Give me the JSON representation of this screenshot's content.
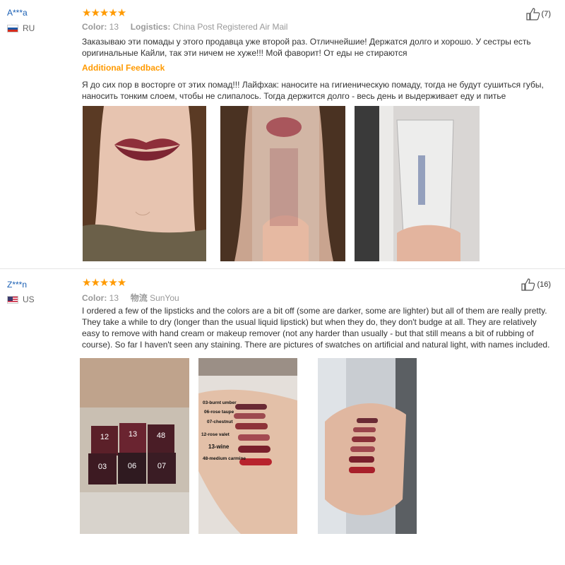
{
  "reviews": [
    {
      "user": "A***a",
      "country": "RU",
      "stars": "★★★★★",
      "color_label": "Color:",
      "color_value": "13",
      "logistics_label": "Logistics:",
      "logistics_value": "China Post Registered Air Mail",
      "likes": "(7)",
      "text": "Заказываю эти помады у этого продавца уже второй раз. Отличнейшие! Держатся долго и хорошо. У сестры есть оригинальные Кайли, так эти ничем не хуже!!! Мой фаворит! От еды не стираются",
      "additional_title": "Additional Feedback",
      "additional_text": "Я до сих пор в восторге от этих помад!!! Лайфхак: наносите на гигиеническую помаду, тогда не будут сушиться губы, наносить тонким слоем, чтобы не слипалось. Тогда держится долго - весь день и выдерживает еду и питье"
    },
    {
      "user": "Z***n",
      "country": "US",
      "stars": "★★★★★",
      "color_label": "Color:",
      "color_value": "13",
      "logistics_label": "物流",
      "logistics_value": "SunYou",
      "likes": "(16)",
      "text": "I ordered a few of the lipsticks and the colors are a bit off (some are darker, some are lighter) but all of them are really pretty. They take a while to dry (longer than the usual liquid lipstick) but when they do, they don't budge at all. They are relatively easy to remove with hand cream or makeup remover (not any harder than usually - but that still means a bit of rubbing of course). So far I haven't seen any staining. There are pictures of swatches on artificial and natural light, with names included."
    }
  ],
  "box_numbers": [
    "12",
    "13",
    "48",
    "03",
    "06",
    "07"
  ],
  "swatch_labels": [
    "03-burnt umber",
    "06-rose taupe",
    "07-chestnut",
    "12-rose valet",
    "13-wine",
    "48-medium carmine"
  ],
  "colors": {
    "accent": "#ff9a00",
    "username": "#1a5fb4",
    "lip": "#8e2f3a"
  }
}
